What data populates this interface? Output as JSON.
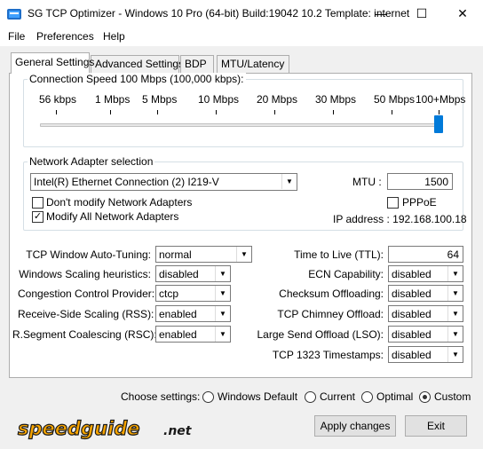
{
  "window": {
    "title": "SG TCP Optimizer - Windows 10 Pro (64-bit) Build:19042 10.2  Template: internet",
    "minimize": "—",
    "maximize": "☐",
    "close": "✕"
  },
  "menu": [
    "File",
    "Preferences",
    "Help"
  ],
  "tabs": [
    "General Settings",
    "Advanced Settings",
    "BDP",
    "MTU/Latency"
  ],
  "connection_speed": {
    "legend": "Connection Speed  100 Mbps (100,000 kbps):",
    "ticks": [
      "56 kbps",
      "1 Mbps",
      "5 Mbps",
      "10 Mbps",
      "20 Mbps",
      "30 Mbps",
      "50 Mbps",
      "100+Mbps"
    ],
    "selected_index": 7
  },
  "adapter": {
    "legend": "Network Adapter selection",
    "selected": "Intel(R) Ethernet Connection (2) I219-V",
    "dont_modify": "Don't modify Network Adapters",
    "dont_modify_checked": false,
    "modify_all": "Modify All Network Adapters",
    "modify_all_checked": true,
    "mtu_label": "MTU :",
    "mtu_value": "1500",
    "pppoe": "PPPoE",
    "pppoe_checked": false,
    "ip_label": "IP address : 192.168.100.18"
  },
  "left_settings": [
    {
      "label": "TCP Window Auto-Tuning:",
      "value": "normal"
    },
    {
      "label": "Windows Scaling heuristics:",
      "value": "disabled"
    },
    {
      "label": "Congestion Control Provider:",
      "value": "ctcp"
    },
    {
      "label": "Receive-Side Scaling (RSS):",
      "value": "enabled"
    },
    {
      "label": "R.Segment Coalescing (RSC):",
      "value": "enabled"
    }
  ],
  "right_settings": {
    "ttl_label": "Time to Live (TTL):",
    "ttl_value": "64",
    "items": [
      {
        "label": "ECN Capability:",
        "value": "disabled"
      },
      {
        "label": "Checksum Offloading:",
        "value": "disabled"
      },
      {
        "label": "TCP Chimney Offload:",
        "value": "disabled"
      },
      {
        "label": "Large Send Offload (LSO):",
        "value": "disabled"
      },
      {
        "label": "TCP 1323 Timestamps:",
        "value": "disabled"
      }
    ]
  },
  "choose": {
    "label": "Choose settings:",
    "options": [
      "Windows Default",
      "Current",
      "Optimal",
      "Custom"
    ],
    "selected": "Custom"
  },
  "buttons": {
    "apply": "Apply changes",
    "exit": "Exit"
  },
  "logo": {
    "text": "speedguide",
    "suffix": ".net",
    "color_main": "#f7a400",
    "color_outline": "#1a1a1a"
  }
}
